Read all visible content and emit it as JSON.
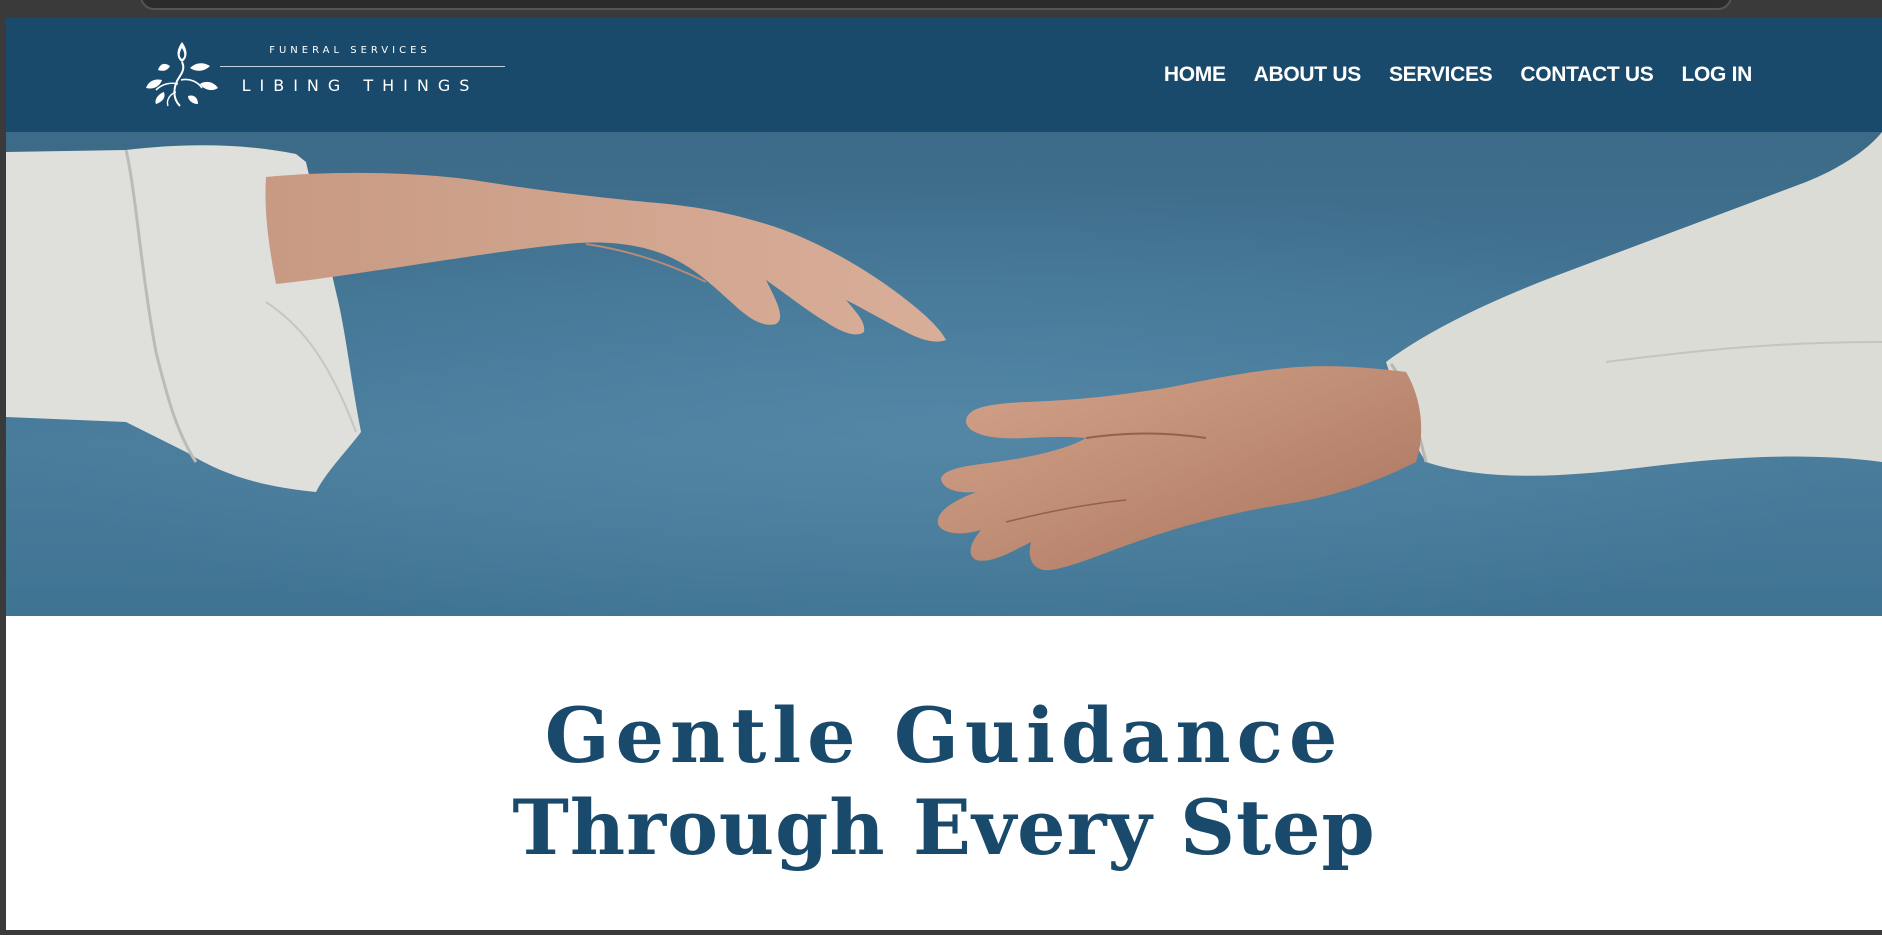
{
  "brand": {
    "tagline": "FUNERAL SERVICES",
    "name": "LIBING THINGS",
    "logo_icon": "leaf-branch-icon"
  },
  "nav": {
    "items": [
      {
        "label": "HOME"
      },
      {
        "label": "ABOUT US"
      },
      {
        "label": "SERVICES"
      },
      {
        "label": "CONTACT US"
      },
      {
        "label": "LOG IN"
      }
    ]
  },
  "hero": {
    "image": "two-hands-reaching"
  },
  "headline": {
    "line1": "Gentle Guidance",
    "line2": "Through Every Step"
  },
  "colors": {
    "brand": "#1a4a6b",
    "sky": "#447797",
    "background": "#ffffff"
  }
}
